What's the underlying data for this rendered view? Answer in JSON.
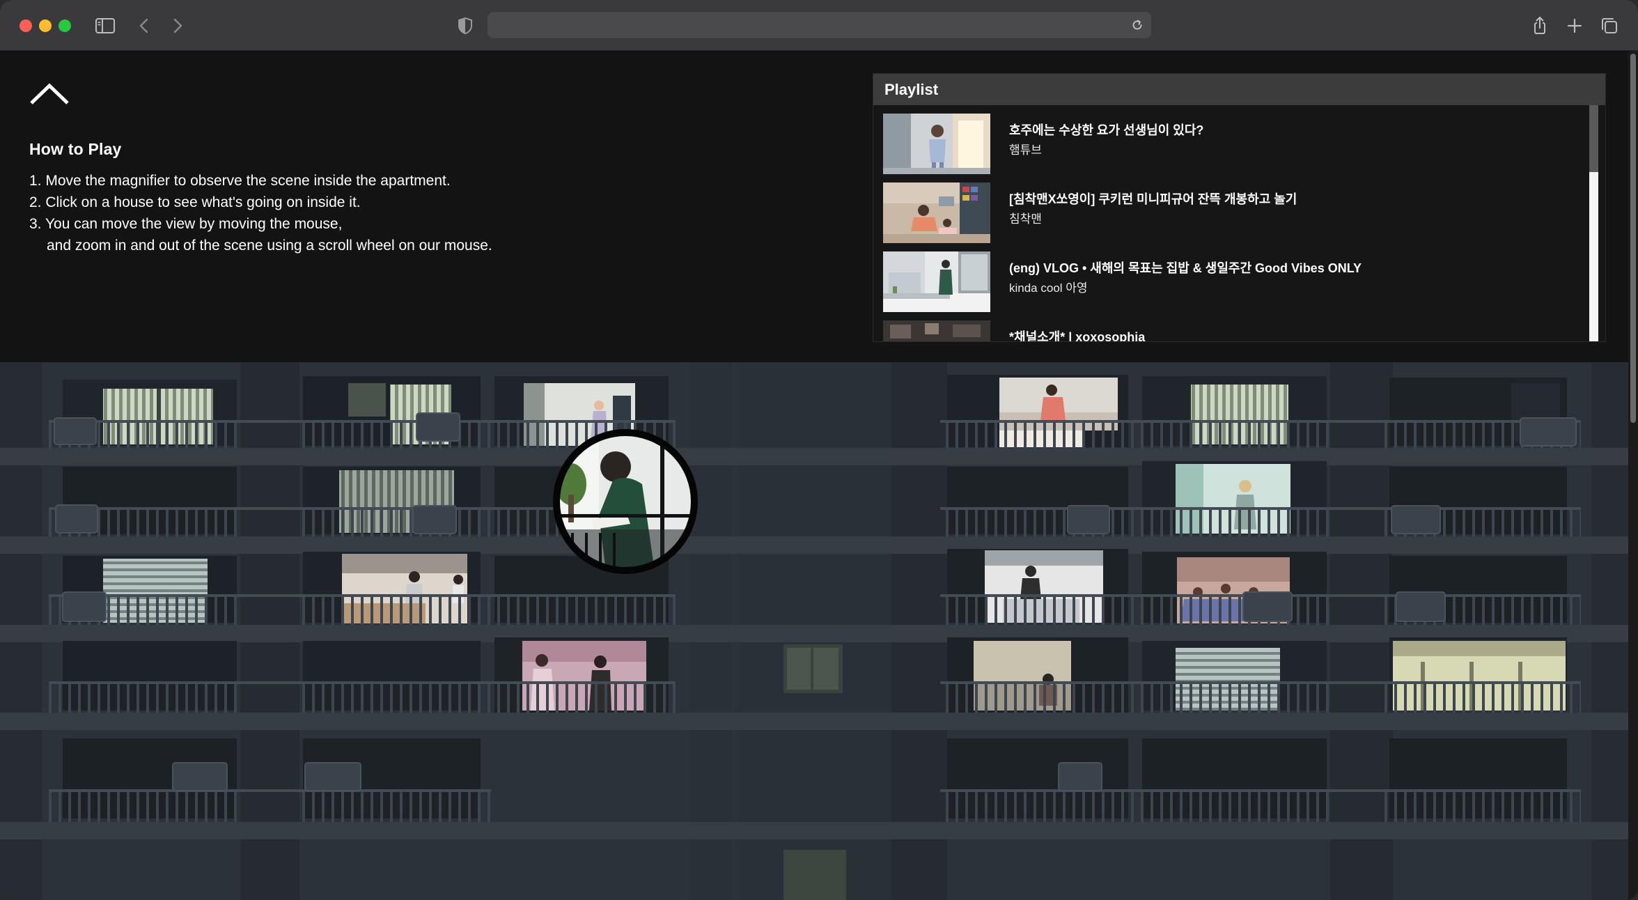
{
  "browser": {
    "url": "",
    "traffic_colors": {
      "close": "#ff5f57",
      "minimize": "#febc2e",
      "zoom": "#28c840"
    },
    "icons": [
      "sidebar-icon",
      "back-icon",
      "forward-icon",
      "privacy-shield-icon",
      "reload-icon",
      "share-icon",
      "new-tab-icon",
      "tab-overview-icon"
    ]
  },
  "instructions": {
    "collapse_icon": "chevron-up-icon",
    "title": "How to Play",
    "steps": [
      "1. Move the magnifier to observe the scene inside the apartment.",
      "2. Click on a house to see what's going on inside it.",
      "3. You can move the view by moving the mouse,",
      "and zoom in and out of the scene using a scroll wheel on our mouse."
    ]
  },
  "playlist": {
    "title": "Playlist",
    "items": [
      {
        "title": "호주에는 수상한 요가 선생님이 있다?",
        "channel": "햄튜브"
      },
      {
        "title": "[침착맨X쏘영이] 쿠키런 미니피규어 잔뜩 개봉하고 놀기",
        "channel": "침착맨"
      },
      {
        "title": "(eng) VLOG • 새해의 목표는 집밥 & 생일주간 Good Vibes ONLY",
        "channel": "kinda cool 아영"
      },
      {
        "title": "*채널소개* | xoxosophia",
        "channel": ""
      }
    ],
    "scroll_position": 0.0
  },
  "scene": {
    "building_color": "#2f353d",
    "magnifier_icon": "magnifier-lens"
  }
}
